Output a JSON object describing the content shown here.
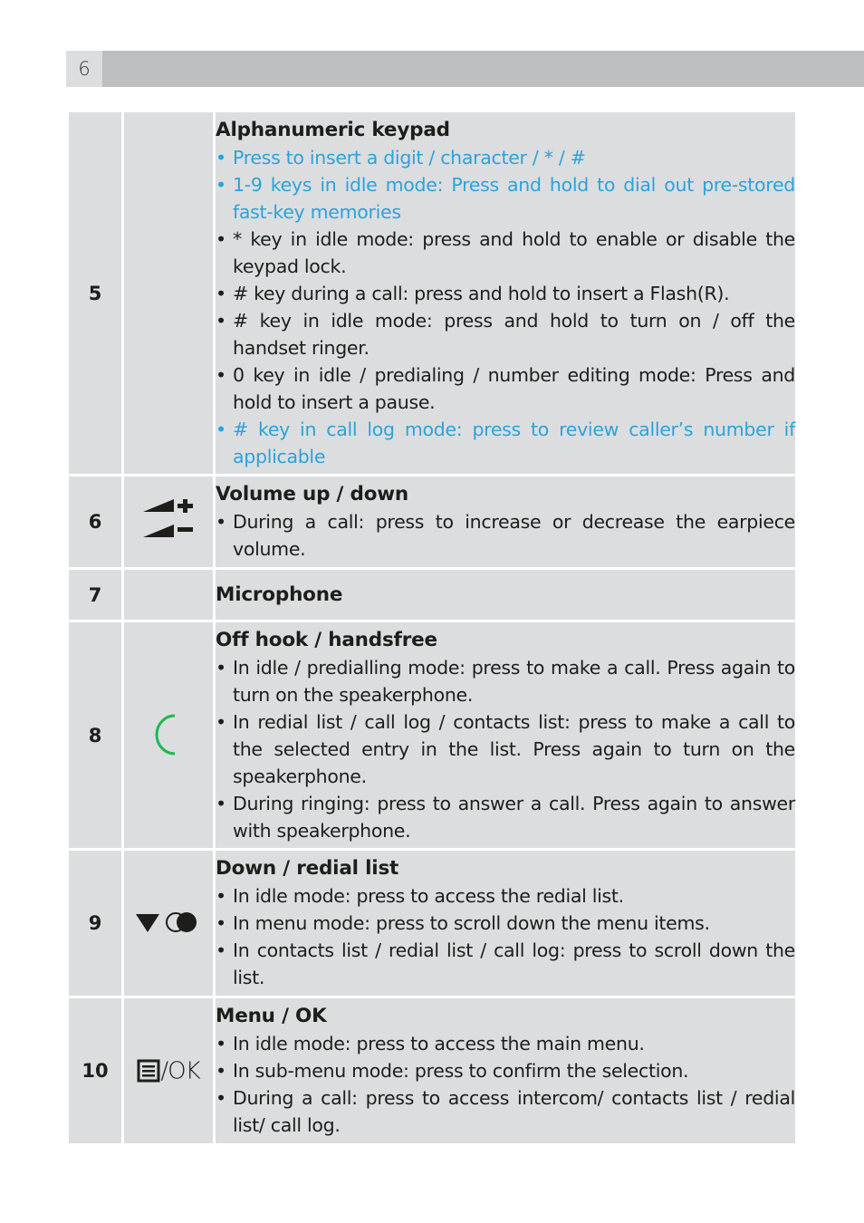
{
  "page": {
    "number": "6"
  },
  "colors": {
    "highlight": "#2aa3db",
    "offhook_icon": "#1db954",
    "cell_bg": "#dcdddf",
    "header_bar": "#bdbec0"
  },
  "rows": [
    {
      "number": "5",
      "icon": "none",
      "title": "Alphanumeric keypad",
      "items": [
        {
          "text": "Press to insert a digit / character / * / #",
          "highlight": true
        },
        {
          "text": "1-9 keys in idle mode: Press and hold to dial out pre-stored fast-key memories",
          "highlight": true
        },
        {
          "text": "* key in idle mode: press and hold to enable or disable the keypad lock.",
          "highlight": false
        },
        {
          "text": "# key during a call: press and hold to insert a Flash(R).",
          "highlight": false
        },
        {
          "text": "# key in idle mode: press and hold to turn on / off the handset ringer.",
          "highlight": false
        },
        {
          "text": "0 key in idle / predialing / number editing mode: Press and hold to insert a pause.",
          "highlight": false
        },
        {
          "text": "# key in call log mode: press to review caller’s number if applicable",
          "highlight": true
        }
      ]
    },
    {
      "number": "6",
      "icon": "volume-up-down-icon",
      "title": "Volume up / down",
      "items": [
        {
          "text": "During a call: press to increase or decrease the earpiece volume.",
          "highlight": false
        }
      ]
    },
    {
      "number": "7",
      "icon": "none",
      "title": "Microphone",
      "items": []
    },
    {
      "number": "8",
      "icon": "off-hook-icon",
      "title": "Off hook / handsfree",
      "items": [
        {
          "text": "In idle / predialling mode: press to make a call. Press again to turn on the speakerphone.",
          "highlight": false
        },
        {
          "text": "In redial list / call log / contacts list: press to make a call to the selected entry in the list. Press again to turn on the speakerphone.",
          "highlight": false
        },
        {
          "text": "During ringing: press to answer a call. Press again to answer with speakerphone.",
          "highlight": false
        }
      ]
    },
    {
      "number": "9",
      "icon": "down-redial-icon",
      "title": "Down / redial list",
      "items": [
        {
          "text": "In idle mode: press to access the redial list.",
          "highlight": false
        },
        {
          "text": "In menu mode: press to scroll down the menu items.",
          "highlight": false
        },
        {
          "text": "In contacts list / redial list / call log: press to scroll down the list.",
          "highlight": false
        }
      ]
    },
    {
      "number": "10",
      "icon": "menu-ok-icon",
      "icon_text": "/OK",
      "title": "Menu / OK",
      "items": [
        {
          "text": "In idle mode: press to access the main menu.",
          "highlight": false
        },
        {
          "text": "In sub-menu mode: press to confirm the selection.",
          "highlight": false
        },
        {
          "text": "During a call: press to access intercom/ contacts list / redial list/ call log.",
          "highlight": false
        }
      ]
    }
  ]
}
